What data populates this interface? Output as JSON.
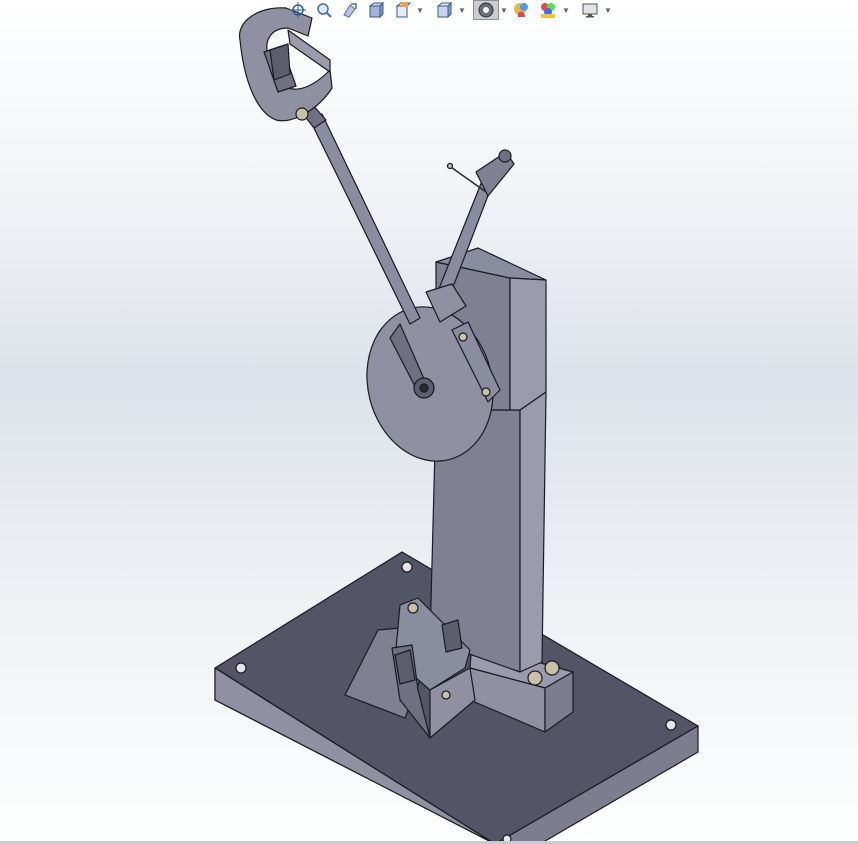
{
  "app": {
    "name": "CAD 3D viewport"
  },
  "viewport": {
    "model_description_colors": {
      "body": "#7f8193",
      "body_light": "#9a9cae",
      "body_dark": "#5c5e6e",
      "base_top": "#535466",
      "base_side": "#8f91a2",
      "edge": "#1a1a22"
    }
  },
  "heads_up_toolbar": {
    "buttons": [
      {
        "icon": "zoom-to-fit-icon",
        "has_dropdown": false,
        "active": false
      },
      {
        "icon": "zoom-to-area-icon",
        "has_dropdown": false,
        "active": false
      },
      {
        "icon": "previous-view-icon",
        "has_dropdown": false,
        "active": false
      },
      {
        "icon": "section-view-icon",
        "has_dropdown": false,
        "active": false
      },
      {
        "icon": "dynamic-annotation-icon",
        "has_dropdown": true,
        "active": false
      },
      {
        "icon": "view-orientation-icon",
        "has_dropdown": true,
        "active": false
      },
      {
        "icon": "display-style-icon",
        "has_dropdown": true,
        "active": true
      },
      {
        "icon": "hide-show-items-icon",
        "has_dropdown": false,
        "active": false
      },
      {
        "icon": "edit-appearance-icon",
        "has_dropdown": true,
        "active": false
      },
      {
        "icon": "view-settings-icon",
        "has_dropdown": true,
        "active": false
      }
    ]
  }
}
